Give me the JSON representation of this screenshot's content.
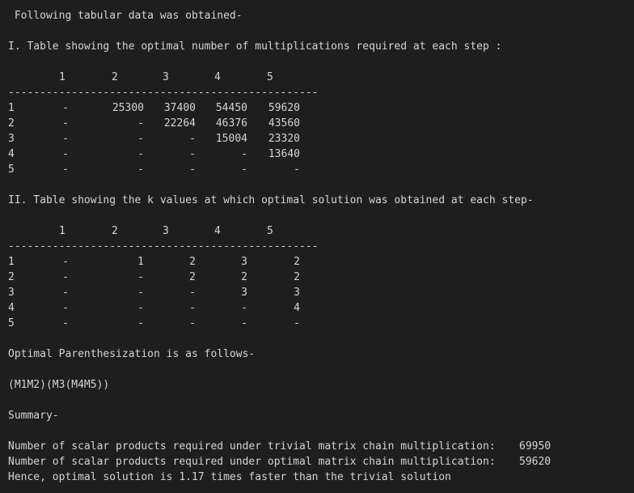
{
  "intro": " Following tabular data was obtained-",
  "table1": {
    "heading": "I. Table showing the optimal number of multiplications required at each step :",
    "columns": [
      "1",
      "2",
      "3",
      "4",
      "5"
    ],
    "rule": "------------------------------------------------------------",
    "rows": [
      {
        "label": "1",
        "cells": [
          "-",
          "25300",
          "37400",
          "54450",
          "59620"
        ]
      },
      {
        "label": "2",
        "cells": [
          "-",
          "-",
          "22264",
          "46376",
          "43560"
        ]
      },
      {
        "label": "3",
        "cells": [
          "-",
          "-",
          "-",
          "15004",
          "23320"
        ]
      },
      {
        "label": "4",
        "cells": [
          "-",
          "-",
          "-",
          "-",
          "13640"
        ]
      },
      {
        "label": "5",
        "cells": [
          "-",
          "-",
          "-",
          "-",
          "-"
        ]
      }
    ]
  },
  "table2": {
    "heading": "II. Table showing the k values at which optimal solution was obtained at each step-",
    "columns": [
      "1",
      "2",
      "3",
      "4",
      "5"
    ],
    "rule": "------------------------------------------------------------",
    "rows": [
      {
        "label": "1",
        "cells": [
          "-",
          "1",
          "2",
          "3",
          "2"
        ]
      },
      {
        "label": "2",
        "cells": [
          "-",
          "-",
          "2",
          "2",
          "2"
        ]
      },
      {
        "label": "3",
        "cells": [
          "-",
          "-",
          "-",
          "3",
          "3"
        ]
      },
      {
        "label": "4",
        "cells": [
          "-",
          "-",
          "-",
          "-",
          "4"
        ]
      },
      {
        "label": "5",
        "cells": [
          "-",
          "-",
          "-",
          "-",
          "-"
        ]
      }
    ]
  },
  "parenthesization": {
    "heading": "Optimal Parenthesization is as follows-",
    "value": "(M1M2)(M3(M4M5))"
  },
  "summary": {
    "heading": "Summary-",
    "trivial_label": "Number of scalar products required under trivial matrix chain multiplication:",
    "trivial_value": "69950",
    "optimal_label": "Number of scalar products required under optimal matrix chain multiplication:",
    "optimal_value": "59620",
    "conclusion": "Hence, optimal solution is 1.17 times faster than the trivial solution"
  }
}
